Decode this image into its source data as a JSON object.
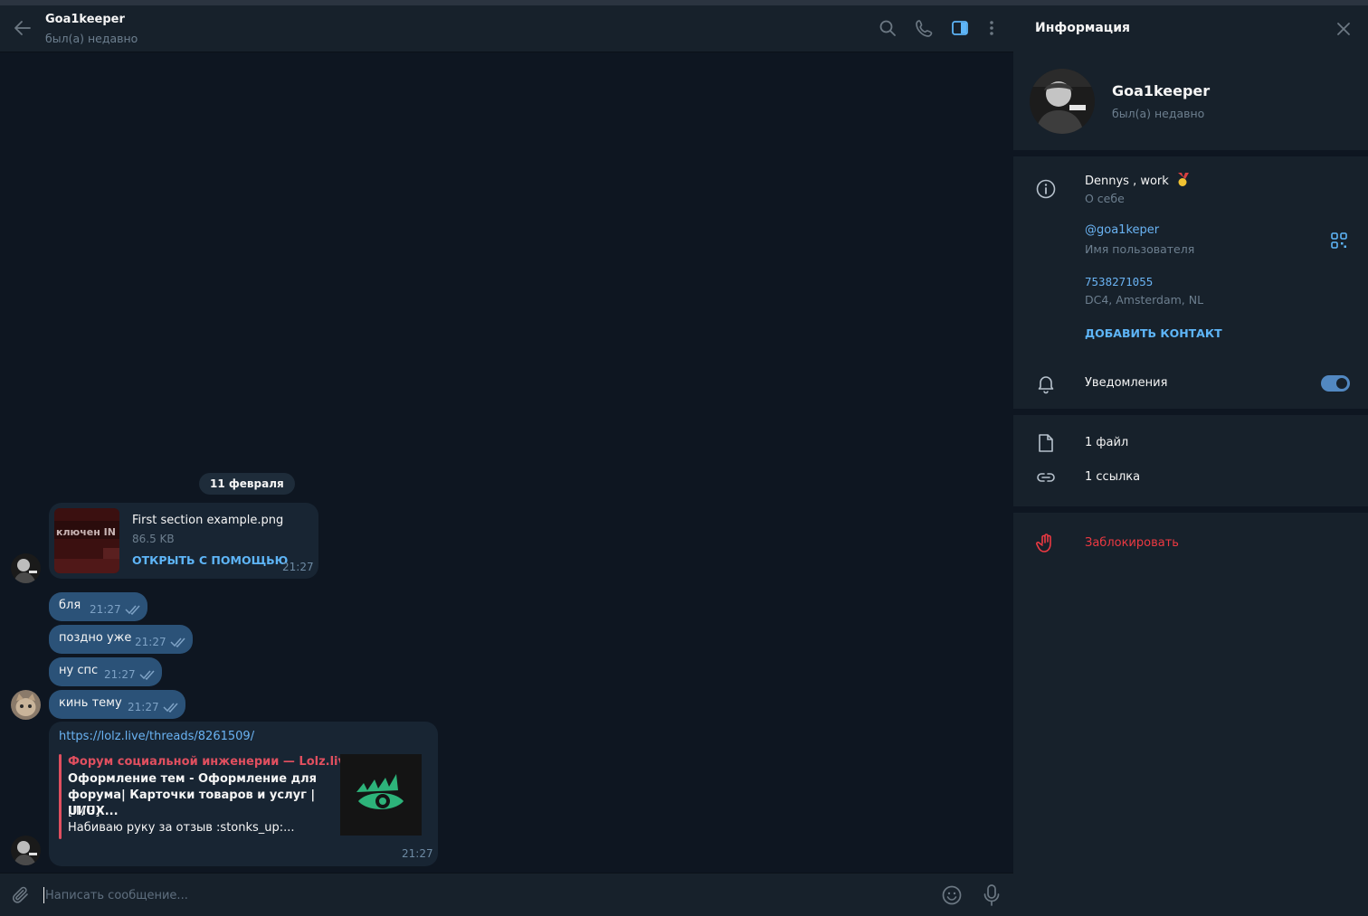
{
  "header": {
    "name": "Goa1keeper",
    "status": "был(а) недавно"
  },
  "messages": {
    "date": "11 февраля",
    "file": {
      "name": "First section example.png",
      "size": "86.5 KB",
      "open_label": "ОТКРЫТЬ С ПОМОЩЬЮ",
      "time": "21:27",
      "thumb_text": "ключен IN"
    },
    "outgoing": [
      {
        "text": "бля",
        "time": "21:27"
      },
      {
        "text": "поздно уже",
        "time": "21:27"
      },
      {
        "text": "ну спс",
        "time": "21:27"
      },
      {
        "text": "кинь тему",
        "time": "21:27"
      }
    ],
    "link": {
      "url": "https://lolz.live/threads/8261509/",
      "site": "Форум социальной инженерии — Lolz.live...",
      "title": "Оформление тем - Оформление для форума| Карточки товаров и услуг | UI/UX...",
      "desc1": "[IMG]",
      "desc2": "Набиваю руку за отзыв :stonks_up:...",
      "time": "21:27"
    }
  },
  "composer": {
    "placeholder": "Написать сообщение..."
  },
  "panel": {
    "title": "Информация",
    "name": "Goa1keeper",
    "status": "был(а) недавно",
    "bio": "Dennys , work",
    "bio_label": "О себе",
    "username": "@goa1keper",
    "username_label": "Имя пользователя",
    "phone": "7538271055",
    "phone_label": "DC4, Amsterdam, NL",
    "add_contact": "ДОБАВИТЬ КОНТАКТ",
    "notifications": "Уведомления",
    "notifications_on": true,
    "files": "1 файл",
    "links": "1 ссылка",
    "block": "Заблокировать"
  },
  "colors": {
    "accent": "#5eb5f7",
    "link": "#6ab3f3",
    "danger": "#ec3942",
    "bubble_out": "#2b5278",
    "bubble_in": "#182533",
    "chat_bg": "#0e1621",
    "panel_bg": "#17212b"
  },
  "icons": [
    "back-arrow-icon",
    "search-icon",
    "phone-icon",
    "sidebar-toggle-icon",
    "more-vertical-icon",
    "attach-icon",
    "emoji-icon",
    "microphone-icon",
    "close-icon",
    "info-icon",
    "qr-code-icon",
    "bell-icon",
    "file-icon",
    "link-icon",
    "hand-stop-icon",
    "read-ticks-icon"
  ]
}
